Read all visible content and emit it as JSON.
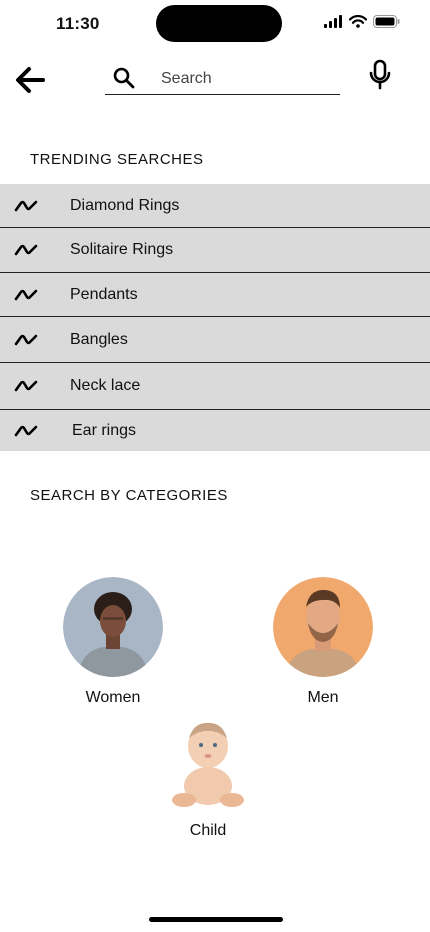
{
  "status_bar": {
    "time": "11:30"
  },
  "search": {
    "placeholder": "Search"
  },
  "trending": {
    "title": "TRENDING SEARCHES",
    "items": [
      {
        "label": "Diamond Rings"
      },
      {
        "label": "Solitaire Rings"
      },
      {
        "label": "Pendants"
      },
      {
        "label": "Bangles"
      },
      {
        "label": "Neck lace"
      },
      {
        "label": "Ear rings"
      }
    ]
  },
  "categories": {
    "title": "SEARCH BY CATEGORIES",
    "items": [
      {
        "label": "Women"
      },
      {
        "label": "Men"
      },
      {
        "label": "Child"
      }
    ]
  },
  "colors": {
    "row_background": "#dadada",
    "divider": "#222222",
    "text": "#111111"
  }
}
